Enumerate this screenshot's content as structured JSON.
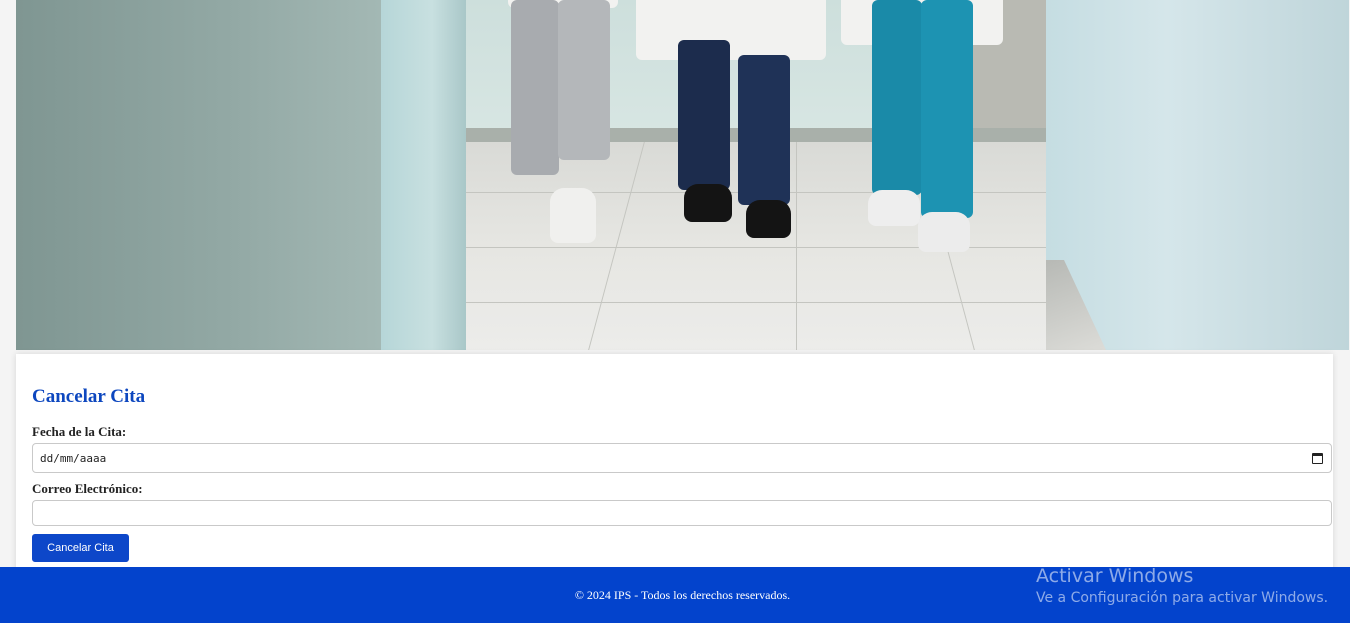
{
  "hero": {
    "image": "medical-staff-walking-photo"
  },
  "form": {
    "title": "Cancelar Cita",
    "date_label": "Fecha de la Cita:",
    "date_value": "dd/mm/aaaa",
    "email_label": "Correo Electrónico:",
    "email_value": "",
    "submit_label": "Cancelar Cita"
  },
  "footer": {
    "text": "© 2024 IPS - Todos los derechos reservados."
  },
  "watermark": {
    "title": "Activar Windows",
    "subtitle": "Ve a Configuración para activar Windows."
  },
  "colors": {
    "accent": "#0d47bf",
    "button": "#0d47c9",
    "footer": "#0343cc"
  }
}
